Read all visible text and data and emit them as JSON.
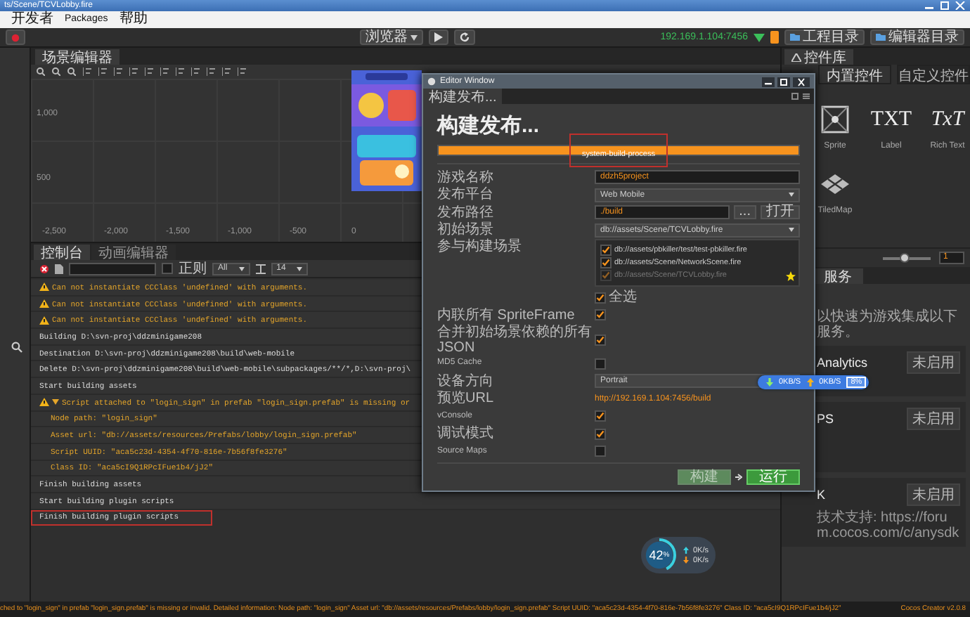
{
  "window": {
    "title": "ts/Scene/TCVLobby.fire"
  },
  "menu": [
    "开发者",
    "Packages",
    "帮助"
  ],
  "toolbar": {
    "browser": "浏览器",
    "ip": "192.169.1.104:7456",
    "buttons": [
      "工程目录",
      "编辑器目录"
    ]
  },
  "scene_editor": {
    "tab": "场景编辑器",
    "y_labels": [
      "1,000",
      "500"
    ],
    "x_labels": [
      "-2,500",
      "-2,000",
      "-1,500",
      "-1,000",
      "-500",
      "0"
    ]
  },
  "console": {
    "tabs": [
      {
        "label": "控制台",
        "selected": true
      },
      {
        "label": "动画编辑器",
        "selected": false
      }
    ],
    "regex": {
      "label": "正则",
      "checked": false
    },
    "level": "All",
    "font_size": "14",
    "lines": [
      {
        "kind": "warn",
        "text": "Can not instantiate CCClass 'undefined' with arguments.",
        "highlighted": false
      },
      {
        "kind": "warn",
        "text": "Can not instantiate CCClass 'undefined' with arguments.",
        "highlighted": false
      },
      {
        "kind": "warn",
        "text": "Can not instantiate CCClass 'undefined' with arguments.",
        "highlighted": false
      },
      {
        "kind": "info",
        "text": "Building D:\\svn-proj\\ddzminigame208",
        "highlighted": false
      },
      {
        "kind": "info",
        "text": "Destination D:\\svn-proj\\ddzminigame208\\build\\web-mobile",
        "highlighted": false
      },
      {
        "kind": "info",
        "text": "Delete D:\\svn-proj\\ddzminigame208\\build\\web-mobile\\subpackages/**/*,D:\\svn-proj\\",
        "highlighted": false
      },
      {
        "kind": "info",
        "text": "Start building assets",
        "highlighted": false
      },
      {
        "kind": "group",
        "text": "Script attached to \"login_sign\" in prefab \"login_sign.prefab\" is missing or",
        "expanded": true,
        "highlighted": false
      },
      {
        "kind": "detail",
        "text": "Node path: \"login_sign\"",
        "highlighted": false
      },
      {
        "kind": "detail",
        "text": "Asset url: \"db://assets/resources/Prefabs/lobby/login_sign.prefab\"",
        "highlighted": false
      },
      {
        "kind": "detail",
        "text": "Script UUID: \"aca5c23d-4354-4f70-816e-7b56f8fe3276\"",
        "highlighted": false
      },
      {
        "kind": "detail",
        "text": "Class ID: \"aca5cI9Q1RPcIFue1b4/jJ2\"",
        "highlighted": false
      },
      {
        "kind": "info",
        "text": "Finish building assets",
        "highlighted": false
      },
      {
        "kind": "info",
        "text": "Start building plugin scripts",
        "highlighted": false
      },
      {
        "kind": "info",
        "text": "Finish building plugin scripts",
        "highlighted": true
      }
    ]
  },
  "build_window": {
    "title": "Editor Window",
    "tab": "构建发布...",
    "heading": "构建发布...",
    "progress": {
      "level": 1,
      "text": "system-build-process",
      "highlighted": true
    },
    "fields": [
      {
        "kind": "text",
        "label": "游戏名称",
        "value": "ddzh5project"
      },
      {
        "kind": "select",
        "label": "发布平台",
        "value": "Web Mobile"
      },
      {
        "kind": "path",
        "label": "发布路径",
        "value": "./build",
        "buttons": [
          "...",
          "打开"
        ]
      },
      {
        "kind": "select",
        "label": "初始场景",
        "value": "db://assets/Scene/TCVLobby.fire"
      },
      {
        "kind": "scenes",
        "label": "参与构建场景",
        "scenes": [
          {
            "path": "db://assets/pbkiller/test/test-pbkiller.fire",
            "checked": true,
            "disabled": false,
            "start": false
          },
          {
            "path": "db://assets/Scene/NetworkScene.fire",
            "checked": true,
            "disabled": false,
            "start": false
          },
          {
            "path": "db://assets/Scene/TCVLobby.fire",
            "checked": true,
            "disabled": true,
            "start": true
          }
        ],
        "select_all": {
          "label": "全选",
          "checked": true
        }
      },
      {
        "kind": "check",
        "label": "内联所有 SpriteFrame",
        "checked": true
      },
      {
        "kind": "check",
        "label": "合并初始场景依赖的所有 JSON",
        "checked": true
      },
      {
        "kind": "check",
        "label": "MD5 Cache",
        "checked": false
      },
      {
        "kind": "select",
        "label": "设备方向",
        "value": "Portrait"
      },
      {
        "kind": "link",
        "label": "预览URL",
        "value": "http://192.169.1.104:7456/build"
      },
      {
        "kind": "check",
        "label": "vConsole",
        "checked": true
      },
      {
        "kind": "check",
        "label": "调试模式",
        "checked": true
      },
      {
        "kind": "check",
        "label": "Source Maps",
        "checked": false
      }
    ],
    "buttons": [
      {
        "label": "构建",
        "disabled": true
      },
      {
        "label": "运行",
        "disabled": false
      }
    ]
  },
  "widget_library": {
    "tab": "控件库",
    "tabs": [
      {
        "label": "内置控件",
        "selected": true
      },
      {
        "label": "自定义控件",
        "selected": false
      }
    ],
    "items": [
      {
        "kind": "sprite",
        "label": "Sprite"
      },
      {
        "kind": "text",
        "label": "Label",
        "glyph": "TXT"
      },
      {
        "kind": "text",
        "label": "Rich Text",
        "glyph": "TxT"
      },
      {
        "kind": "tiledmap",
        "label": "TiledMap"
      }
    ],
    "zoom": {
      "level": 0.45,
      "value": "1"
    }
  },
  "services": {
    "tab": "服务",
    "intro": "以快速为游戏集成以下服务。",
    "cards": [
      {
        "title": "Analytics",
        "button": "未启用"
      },
      {
        "title": "PS",
        "button": "未启用"
      },
      {
        "title": "K",
        "button": "未启用",
        "text": "技术支持: https://forum.cocos.com/c/anysdk"
      }
    ]
  },
  "network_overlay": {
    "download": "0KB/S",
    "upload": "0KB/S",
    "cpu": "8%"
  },
  "perf_widget": {
    "level": 0.42,
    "percent": "42",
    "unit": "%",
    "upload": "0K/s",
    "download": "0K/s"
  },
  "status_bar": {
    "message": "ched to \"login_sign\" in prefab \"login_sign.prefab\" is missing or invalid. Detailed information: Node path: \"login_sign\" Asset url: \"db://assets/resources/Prefabs/lobby/login_sign.prefab\" Script UUID: \"aca5c23d-4354-4f70-816e-7b56f8fe3276\" Class ID: \"aca5cI9Q1RPcIFue1b4/jJ2\"",
    "version": "Cocos Creator v2.0.8"
  }
}
